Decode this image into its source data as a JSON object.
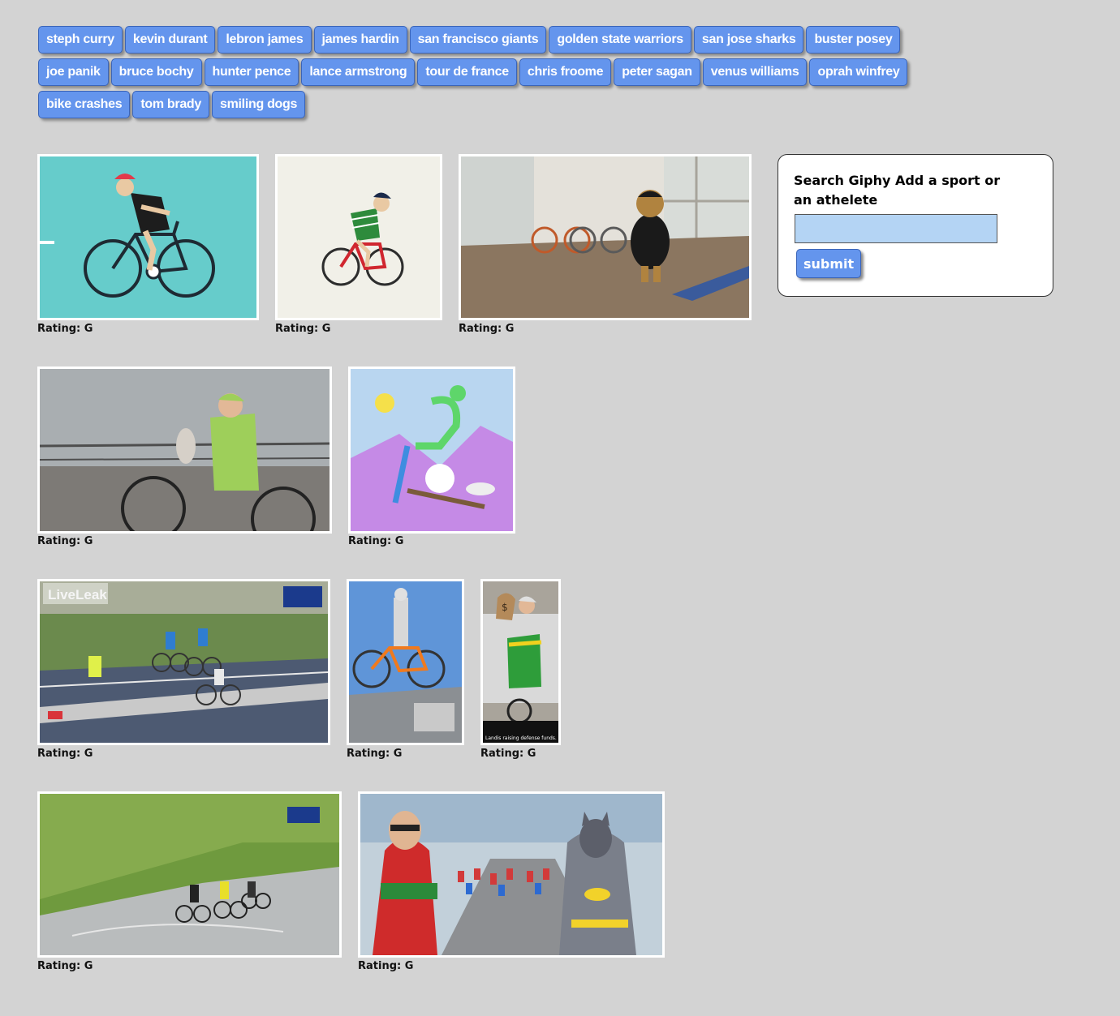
{
  "tags": [
    [
      "steph curry",
      "kevin durant",
      "lebron james",
      "james hardin",
      "san francisco giants",
      "golden state warriors",
      "san jose sharks",
      "buster posey"
    ],
    [
      "joe panik",
      "bruce bochy",
      "hunter pence",
      "lance armstrong",
      "tour de france",
      "chris froome",
      "peter sagan",
      "venus williams",
      "oprah winfrey"
    ],
    [
      "bike crashes",
      "tom brady",
      "smiling dogs"
    ]
  ],
  "search": {
    "label": "Search Giphy Add a sport or an athelete",
    "input_value": "",
    "submit_label": "submit"
  },
  "gifs": [
    {
      "rating": "Rating: G",
      "subject": "cartoon-cyclist-teal"
    },
    {
      "rating": "Rating: G",
      "subject": "cartoon-cyclist-green-jersey"
    },
    {
      "rating": "Rating: G",
      "subject": "mascot-bear-bikes-room"
    },
    {
      "rating": "Rating: G",
      "subject": "cyclist-cannondale-jersey"
    },
    {
      "rating": "Rating: G",
      "subject": "exercise-bike-illustration"
    },
    {
      "rating": "Rating: G",
      "subject": "race-peloton-crash",
      "overlay": "LiveLeak"
    },
    {
      "rating": "Rating: G",
      "subject": "bikes-on-car-roof"
    },
    {
      "rating": "Rating: G",
      "subject": "landis-raising-funds",
      "overlay": "Landis raising defense funds."
    },
    {
      "rating": "Rating: G",
      "subject": "mountain-climb-riders"
    },
    {
      "rating": "Rating: G",
      "subject": "batman-robin-peloton"
    }
  ]
}
